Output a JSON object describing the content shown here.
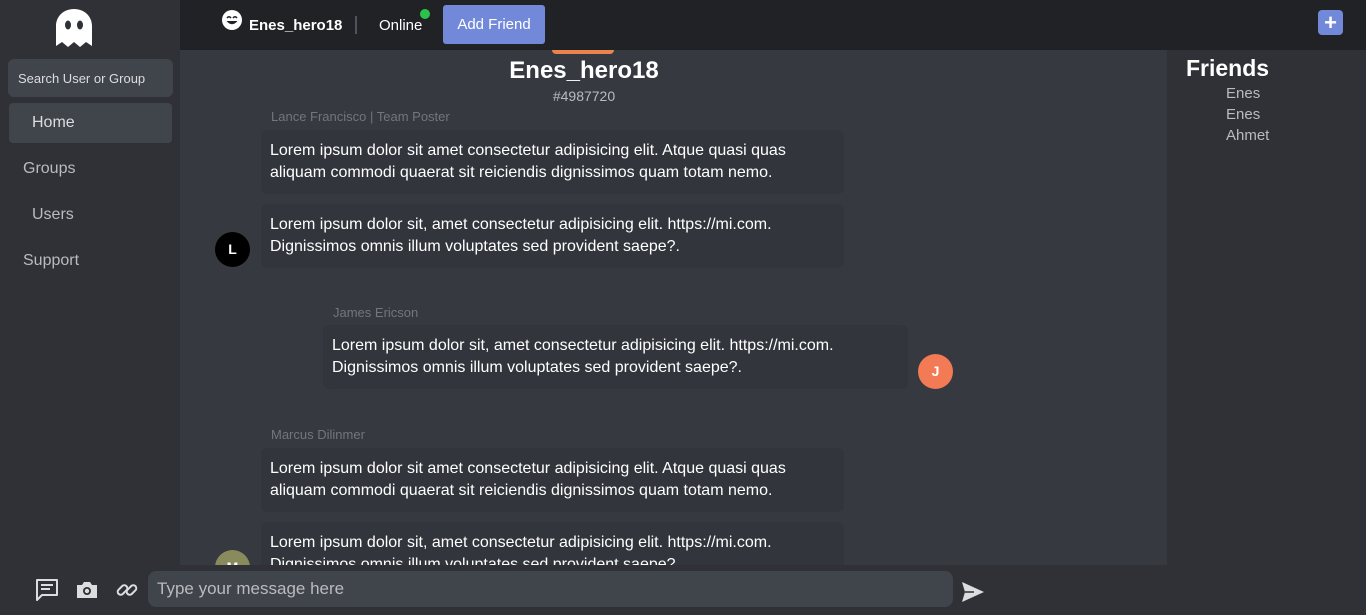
{
  "sidebar": {
    "search_placeholder": "Search User or Group",
    "items": [
      {
        "label": "Home",
        "active": true
      },
      {
        "label": "Groups"
      },
      {
        "label": "Users"
      },
      {
        "label": "Support"
      }
    ]
  },
  "topbar": {
    "username": "Enes_hero18",
    "status": "Online",
    "add_friend_label": "Add Friend",
    "new_icon": "plus-square-icon"
  },
  "chat": {
    "title": "Enes_hero18",
    "tag": "#4987720",
    "messages": [
      {
        "sender": "Lance Francisco | Team Poster",
        "avatar_letter": "L",
        "avatar_color": "#000000",
        "side": "left",
        "bubbles": [
          "Lorem ipsum dolor sit amet consectetur adipisicing elit. Atque quasi quas aliquam commodi quaerat sit reiciendis dignissimos quam totam nemo.",
          "Lorem ipsum dolor sit, amet consectetur adipisicing elit. https://mi.com. Dignissimos omnis illum voluptates sed provident saepe?."
        ]
      },
      {
        "sender": "James Ericson",
        "avatar_letter": "J",
        "avatar_color": "#f27a54",
        "side": "right",
        "bubbles": [
          "Lorem ipsum dolor sit, amet consectetur adipisicing elit. https://mi.com. Dignissimos omnis illum voluptates sed provident saepe?."
        ]
      },
      {
        "sender": "Marcus Dilinmer",
        "avatar_letter": "M",
        "avatar_color": "#8a8b5c",
        "side": "left",
        "bubbles": [
          "Lorem ipsum dolor sit amet consectetur adipisicing elit. Atque quasi quas aliquam commodi quaerat sit reiciendis dignissimos quam totam nemo.",
          "Lorem ipsum dolor sit, amet consectetur adipisicing elit. https://mi.com. Dignissimos omnis illum voluptates sed provident saepe?."
        ]
      }
    ]
  },
  "friends": {
    "title": "Friends",
    "list": [
      "Enes",
      "Enes",
      "Ahmet"
    ]
  },
  "composer": {
    "placeholder": "Type your message here",
    "icons": [
      "message-icon",
      "camera-icon",
      "link-icon",
      "send-icon"
    ]
  },
  "colors": {
    "accent": "#7289da",
    "online": "#2cc34b"
  }
}
